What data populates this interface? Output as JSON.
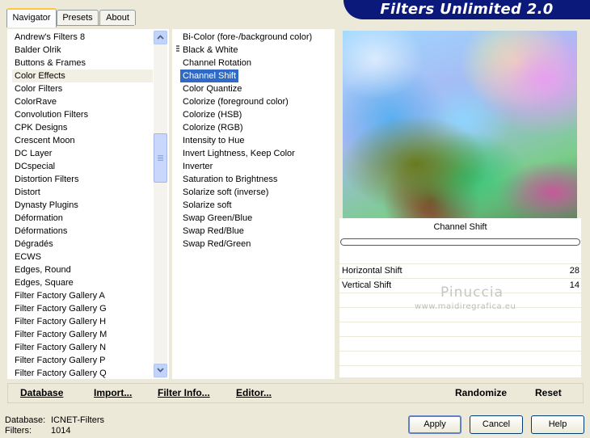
{
  "title": "Filters Unlimited 2.0",
  "tabs": [
    {
      "label": "Navigator"
    },
    {
      "label": "Presets"
    },
    {
      "label": "About"
    }
  ],
  "categories": [
    "Andrew's Filters 8",
    "Balder Olrik",
    "Buttons & Frames",
    "Color Effects",
    "Color Filters",
    "ColorRave",
    "Convolution Filters",
    "CPK Designs",
    "Crescent Moon",
    "DC Layer",
    "DCspecial",
    "Distortion Filters",
    "Distort",
    "Dynasty Plugins",
    "Déformation",
    "Déformations",
    "Dégradés",
    "ECWS",
    "Edges, Round",
    "Edges, Square",
    "Filter Factory Gallery A",
    "Filter Factory Gallery G",
    "Filter Factory Gallery H",
    "Filter Factory Gallery M",
    "Filter Factory Gallery N",
    "Filter Factory Gallery P",
    "Filter Factory Gallery Q"
  ],
  "selected_category": "Color Effects",
  "filters": [
    "Bi-Color (fore-/background color)",
    "Black & White",
    "Channel Rotation",
    "Channel Shift",
    "Color Quantize",
    "Colorize (foreground color)",
    "Colorize (HSB)",
    "Colorize (RGB)",
    "Intensity to Hue",
    "Invert Lightness, Keep Color",
    "Inverter",
    "Saturation to Brightness",
    "Solarize soft (inverse)",
    "Solarize soft",
    "Swap Green/Blue",
    "Swap Red/Blue",
    "Swap Red/Green"
  ],
  "selected_filter": "Channel Shift",
  "preview": {
    "caption": "Channel Shift",
    "progress": 0
  },
  "params": [
    {
      "label": "Horizontal Shift",
      "value": "28"
    },
    {
      "label": "Vertical Shift",
      "value": "14"
    }
  ],
  "watermark": {
    "name": "Pinuccia",
    "url": "www.maidiregrafica.eu"
  },
  "toolbar": {
    "database": "Database",
    "import": "Import...",
    "filter_info": "Filter Info...",
    "editor": "Editor...",
    "randomize": "Randomize",
    "reset": "Reset"
  },
  "status": {
    "database_label": "Database:",
    "database_value": "ICNET-Filters",
    "filters_label": "Filters:",
    "filters_value": "1014"
  },
  "buttons": {
    "apply": "Apply",
    "cancel": "Cancel",
    "help": "Help"
  },
  "colors": {
    "banner": "#0b1a7a",
    "selection": "#316ac5"
  }
}
